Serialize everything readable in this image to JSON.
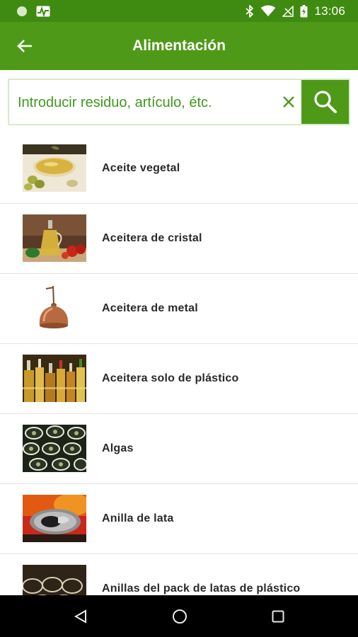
{
  "status_bar": {
    "time": "13:06",
    "icons": [
      "circle-notification-icon",
      "activity-icon",
      "bluetooth-icon",
      "wifi-icon",
      "no-signal-icon",
      "battery-icon"
    ]
  },
  "app_bar": {
    "title": "Alimentación",
    "back_icon": "arrow-left-icon"
  },
  "search": {
    "placeholder": "Introducir residuo, artículo, étc.",
    "value": "",
    "clear_icon": "close-icon",
    "search_icon": "magnifier-icon"
  },
  "items": [
    {
      "label": "Aceite vegetal",
      "thumbnail": "olive-oil-bowl-photo"
    },
    {
      "label": "Aceitera de cristal",
      "thumbnail": "glass-oil-cruet-photo"
    },
    {
      "label": "Aceitera de metal",
      "thumbnail": "copper-oil-can-photo"
    },
    {
      "label": "Aceitera solo de plástico",
      "thumbnail": "plastic-oil-bottles-photo"
    },
    {
      "label": "Algas",
      "thumbnail": "sushi-rolls-photo"
    },
    {
      "label": "Anilla de lata",
      "thumbnail": "can-pull-tab-photo"
    },
    {
      "label": "Anillas del pack de latas de plástico",
      "thumbnail": "plastic-six-pack-rings-photo"
    }
  ],
  "nav_bar": {
    "icons": [
      "back-triangle-icon",
      "home-circle-icon",
      "recents-square-icon"
    ]
  },
  "colors": {
    "status_bar": "#3f8a10",
    "app_bar": "#4e9a18",
    "accent_text": "#3f9a1c",
    "search_border": "#d7ebc7",
    "divider": "#e3e3e3"
  }
}
